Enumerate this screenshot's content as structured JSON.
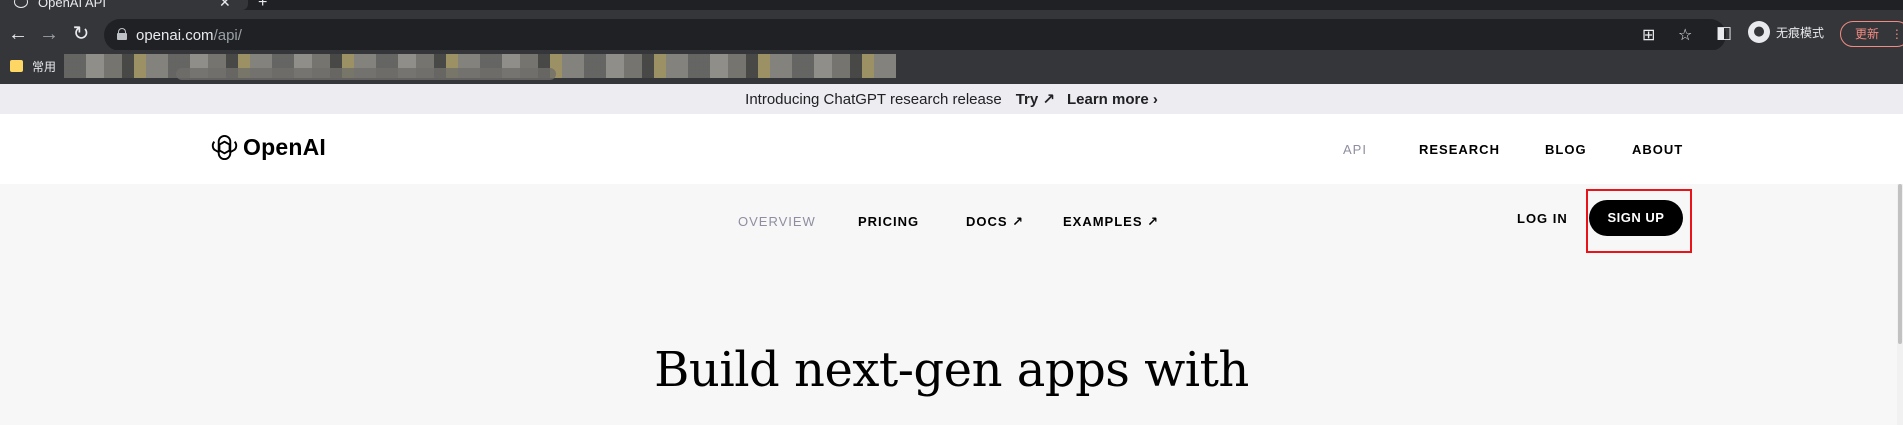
{
  "browser": {
    "tab_title": "OpenAI API",
    "tab_close": "✕",
    "new_tab": "+",
    "url_host": "openai.com",
    "url_path": "/api/",
    "incognito_label": "无痕模式",
    "update_label": "更新",
    "bookmark_label": "常用",
    "icons": {
      "back": "←",
      "forward": "→",
      "reload": "↻",
      "qr": "⊞",
      "star": "☆",
      "sidepanel": "◧",
      "menu": "⋮"
    }
  },
  "announcement": {
    "text": "Introducing ChatGPT research release",
    "try_label": "Try ↗",
    "learn_label": "Learn more ›"
  },
  "site": {
    "logo_text": "OpenAI",
    "top_nav": [
      "API",
      "RESEARCH",
      "BLOG",
      "ABOUT"
    ],
    "sub_nav": {
      "overview": "OVERVIEW",
      "pricing": "PRICING",
      "docs": "DOCS ↗",
      "examples": "EXAMPLES ↗"
    },
    "login_label": "LOG IN",
    "signup_label": "SIGN UP",
    "hero_title": "Build next-gen apps with"
  },
  "colors": {
    "highlight_box": "#e8141a",
    "muted_nav": "#8e8ea0",
    "announcement_bg": "#ececf1"
  }
}
